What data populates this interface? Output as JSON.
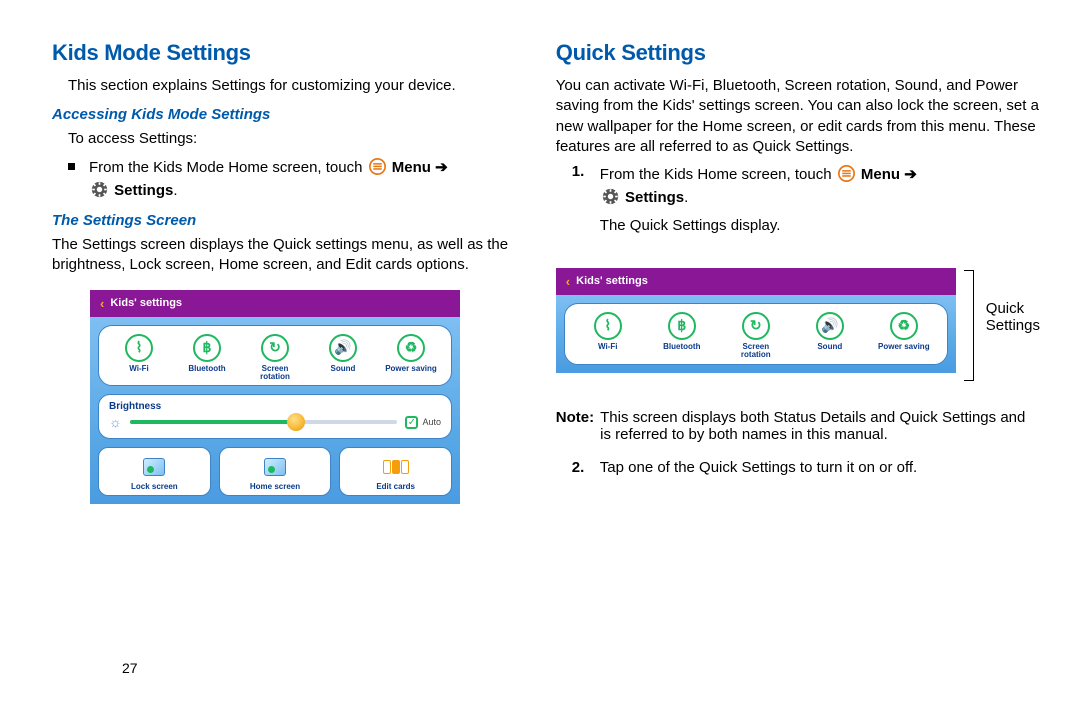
{
  "page_number": "27",
  "left": {
    "h1": "Kids Mode Settings",
    "intro": "This section explains Settings for customizing your device.",
    "h2a": "Accessing Kids Mode Settings",
    "to_access": "To access Settings:",
    "bullet_pre": "From the Kids Mode Home screen, touch",
    "menu_word": "Menu",
    "arrow": "➔",
    "settings_word": "Settings",
    "period": ".",
    "h2b": "The Settings Screen",
    "settings_para": "The Settings screen displays the Quick settings menu, as well as the brightness, Lock screen, Home screen, and Edit cards options."
  },
  "right": {
    "h1": "Quick Settings",
    "para": "You can activate Wi-Fi, Bluetooth, Screen rotation, Sound, and Power saving from the Kids' settings screen. You can also lock the screen, set a new wallpaper for the Home screen, or edit cards from this menu. These features are all referred to as Quick Settings.",
    "step1_pre": "From the Kids Home screen, touch",
    "step1_post": "The Quick Settings display.",
    "callout": "Quick\nSettings",
    "note_label": "Note:",
    "note_body": "This screen displays both Status Details and Quick Settings and is referred to by both names in this manual.",
    "step2": "Tap one of the Quick Settings to turn it on or off."
  },
  "panel": {
    "title": "Kids' settings",
    "items": [
      {
        "label": "Wi-Fi",
        "glyph": "⌇"
      },
      {
        "label": "Bluetooth",
        "glyph": "฿"
      },
      {
        "label": "Screen\nrotation",
        "glyph": "↻"
      },
      {
        "label": "Sound",
        "glyph": "🔊"
      },
      {
        "label": "Power saving",
        "glyph": "♻"
      }
    ],
    "brightness_label": "Brightness",
    "auto_label": "Auto",
    "cards": [
      {
        "label": "Lock screen"
      },
      {
        "label": "Home screen"
      },
      {
        "label": "Edit cards"
      }
    ]
  }
}
